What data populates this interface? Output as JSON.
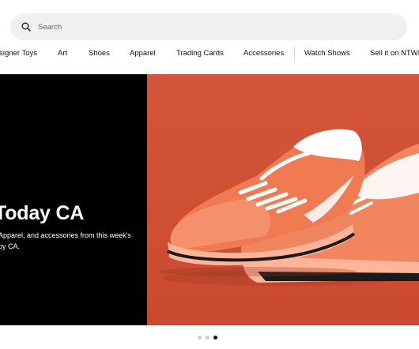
{
  "search": {
    "placeholder": "Search",
    "icon": "search-icon"
  },
  "nav": {
    "items": [
      "Designer Toys",
      "Art",
      "Shoes",
      "Apparel",
      "Trading Cards",
      "Accessories",
      "Watch Shows",
      "Sell it on NTWRK"
    ]
  },
  "hero": {
    "title": "Today CA",
    "description_line1": "Apparel, and accessories from this week's",
    "description_line2": "by CA.",
    "image_colors": {
      "left_panel": "#000000",
      "right_panel": "#d3553a",
      "shoe": "#f07a52"
    }
  },
  "carousel": {
    "total_slides": 3,
    "active_slide": 3
  }
}
